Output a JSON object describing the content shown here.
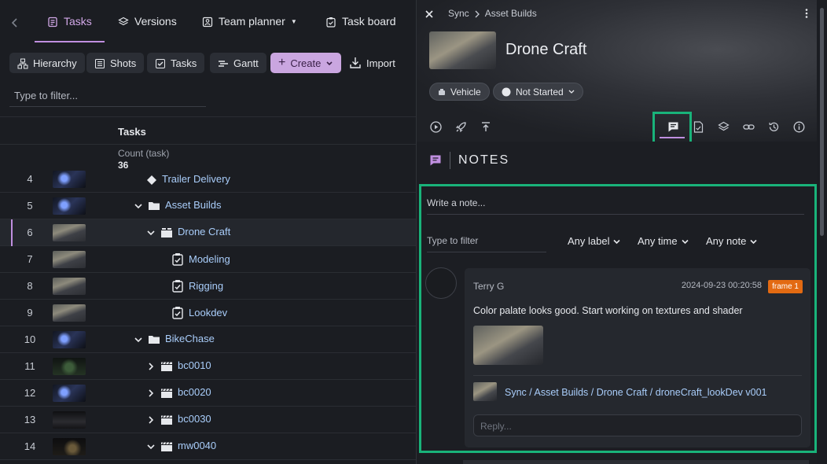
{
  "nav": {
    "tabs": [
      {
        "label": "Tasks",
        "icon": "tasks-icon"
      },
      {
        "label": "Versions",
        "icon": "layers-icon"
      },
      {
        "label": "Team planner",
        "icon": "team-planner-icon"
      },
      {
        "label": "Task board",
        "icon": "task-board-icon"
      }
    ]
  },
  "toolbar": {
    "hierarchy": "Hierarchy",
    "shots": "Shots",
    "tasks": "Tasks",
    "gantt": "Gantt",
    "create": "Create",
    "import": "Import"
  },
  "list": {
    "filter_placeholder": "Type to filter...",
    "column_header": "Tasks",
    "count_label": "Count (task)",
    "count_value": "36",
    "rows": [
      {
        "num": "4",
        "name": "Trailer Delivery",
        "type": "milestone"
      },
      {
        "num": "5",
        "name": "Asset Builds",
        "type": "folder"
      },
      {
        "num": "6",
        "name": "Drone Craft",
        "type": "asset"
      },
      {
        "num": "7",
        "name": "Modeling",
        "type": "task"
      },
      {
        "num": "8",
        "name": "Rigging",
        "type": "task"
      },
      {
        "num": "9",
        "name": "Lookdev",
        "type": "task"
      },
      {
        "num": "10",
        "name": "BikeChase",
        "type": "folder"
      },
      {
        "num": "11",
        "name": "bc0010",
        "type": "shot"
      },
      {
        "num": "12",
        "name": "bc0020",
        "type": "shot"
      },
      {
        "num": "13",
        "name": "bc0030",
        "type": "shot"
      },
      {
        "num": "14",
        "name": "mw0040",
        "type": "shot"
      }
    ]
  },
  "panel": {
    "breadcrumb": [
      "Sync",
      "Asset Builds"
    ],
    "title": "Drone Craft",
    "type_chip": "Vehicle",
    "status_chip": "Not Started",
    "section_title": "NOTES",
    "write_placeholder": "Write a note...",
    "note_filter_placeholder": "Type to filter",
    "dropdowns": [
      "Any label",
      "Any time",
      "Any note"
    ],
    "note": {
      "author": "Terry G",
      "date": "2024-09-23 00:20:58",
      "badge": "frame 1",
      "text": "Color palate looks good. Start working on textures and shader",
      "version_link": "Sync / Asset Builds / Drone Craft / droneCraft_lookDev v001",
      "reply_placeholder": "Reply..."
    }
  },
  "colors": {
    "accent": "#c08fe0",
    "highlight": "#19b37a",
    "link": "#a9cdfa",
    "badge": "#e36a12"
  }
}
